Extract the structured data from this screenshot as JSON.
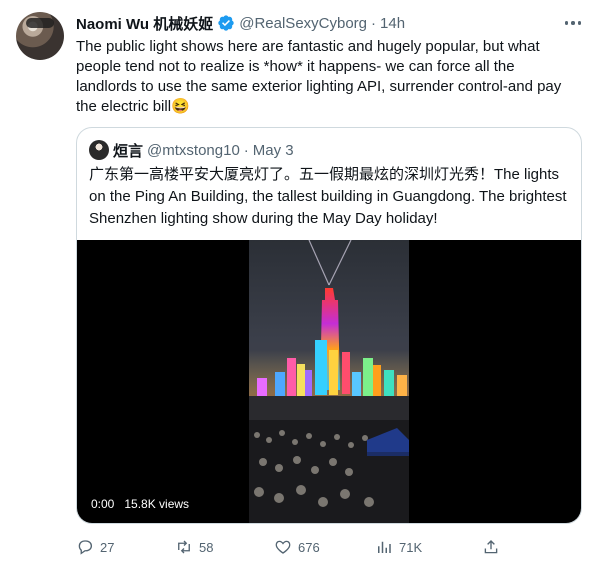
{
  "tweet": {
    "author_name": "Naomi Wu 机械妖姬",
    "author_handle": "@RealSexyCyborg",
    "separator": "·",
    "time": "14h",
    "text": "The public light shows here are fantastic and hugely popular, but what people tend not to realize is *how* it happens- we can force all the landlords to use the same exterior lighting API, surrender control-and  pay the electric bill",
    "emoji": "😆"
  },
  "quoted": {
    "author_name": "烜言",
    "author_handle": "@mtxstong10",
    "separator": "·",
    "time": "May 3",
    "text": "广东第一高楼平安大厦亮灯了。五一假期最炫的深圳灯光秀！The lights on the Ping An Building, the tallest building in Guangdong. The brightest Shenzhen lighting show during the May Day holiday!",
    "video": {
      "duration": "0:00",
      "views": "15.8K views"
    }
  },
  "actions": {
    "replies": "27",
    "retweets": "58",
    "likes": "676",
    "views": "71K"
  },
  "colors": {
    "text_primary": "#0f1419",
    "text_secondary": "#536471",
    "border": "#cfd9de",
    "verified": "#1d9bf0"
  }
}
